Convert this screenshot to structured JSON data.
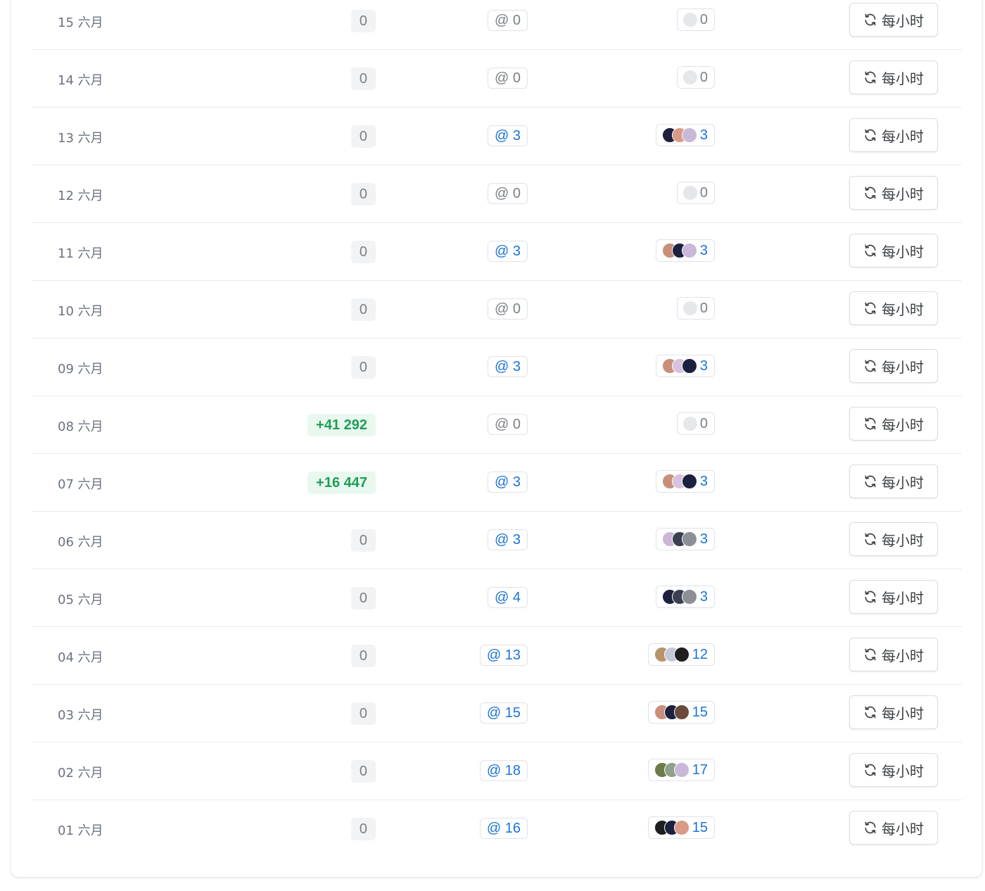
{
  "colors": {
    "positive_delta": "#1f9d55",
    "positive_delta_bg": "#e9f8ef",
    "link_blue": "#1a73d9",
    "muted_gray": "#7b8087"
  },
  "rows": [
    {
      "date": "15 六月",
      "delta": "0",
      "mentions": "@ 0",
      "users_count": "0",
      "avatars": [],
      "frequency": "每小时"
    },
    {
      "date": "14 六月",
      "delta": "0",
      "mentions": "@ 0",
      "users_count": "0",
      "avatars": [],
      "frequency": "每小时"
    },
    {
      "date": "13 六月",
      "delta": "0",
      "mentions": "@ 3",
      "users_count": "3",
      "avatars": [
        "#1d2140",
        "#d99a86",
        "#c9b8d8"
      ],
      "frequency": "每小时"
    },
    {
      "date": "12 六月",
      "delta": "0",
      "mentions": "@ 0",
      "users_count": "0",
      "avatars": [],
      "frequency": "每小时"
    },
    {
      "date": "11 六月",
      "delta": "0",
      "mentions": "@ 3",
      "users_count": "3",
      "avatars": [
        "#c98f7a",
        "#1d2140",
        "#c9b8d8"
      ],
      "frequency": "每小时"
    },
    {
      "date": "10 六月",
      "delta": "0",
      "mentions": "@ 0",
      "users_count": "0",
      "avatars": [],
      "frequency": "每小时"
    },
    {
      "date": "09 六月",
      "delta": "0",
      "mentions": "@ 3",
      "users_count": "3",
      "avatars": [
        "#c98f7a",
        "#d8c2dd",
        "#1d2140"
      ],
      "frequency": "每小时"
    },
    {
      "date": "08 六月",
      "delta": "+41 292",
      "mentions": "@ 0",
      "users_count": "0",
      "avatars": [],
      "frequency": "每小时"
    },
    {
      "date": "07 六月",
      "delta": "+16 447",
      "mentions": "@ 3",
      "users_count": "3",
      "avatars": [
        "#c98f7a",
        "#d8c2dd",
        "#1d2140"
      ],
      "frequency": "每小时"
    },
    {
      "date": "06 六月",
      "delta": "0",
      "mentions": "@ 3",
      "users_count": "3",
      "avatars": [
        "#cbb6d6",
        "#3b3f52",
        "#8c8f96"
      ],
      "frequency": "每小时"
    },
    {
      "date": "05 六月",
      "delta": "0",
      "mentions": "@ 4",
      "users_count": "3",
      "avatars": [
        "#1d2140",
        "#3b3f52",
        "#8c8f96"
      ],
      "frequency": "每小时"
    },
    {
      "date": "04 六月",
      "delta": "0",
      "mentions": "@ 13",
      "users_count": "12",
      "avatars": [
        "#b9946a",
        "#c4c9d6",
        "#1f1f1f"
      ],
      "frequency": "每小时"
    },
    {
      "date": "03 六月",
      "delta": "0",
      "mentions": "@ 15",
      "users_count": "15",
      "avatars": [
        "#c98f7a",
        "#1d2140",
        "#6b4a3a"
      ],
      "frequency": "每小时"
    },
    {
      "date": "02 六月",
      "delta": "0",
      "mentions": "@ 18",
      "users_count": "17",
      "avatars": [
        "#6d7a4a",
        "#8fa08c",
        "#c9b8d8"
      ],
      "frequency": "每小时"
    },
    {
      "date": "01 六月",
      "delta": "0",
      "mentions": "@ 16",
      "users_count": "15",
      "avatars": [
        "#1f1f1f",
        "#1d2140",
        "#d99a86"
      ],
      "frequency": "每小时"
    }
  ]
}
